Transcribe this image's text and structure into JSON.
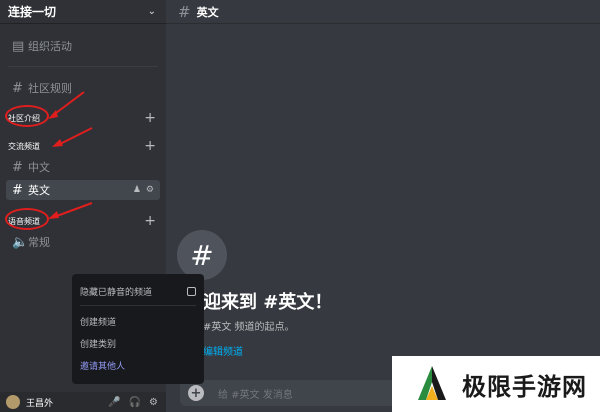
{
  "server": {
    "name": "连接一切"
  },
  "sidebar": {
    "top_item": "组织活动",
    "channels": [
      {
        "label": "社区规则"
      },
      {
        "label": "中文"
      },
      {
        "label": "英文"
      },
      {
        "label": "常规"
      }
    ],
    "categories": [
      {
        "label": "社区介绍"
      },
      {
        "label": "交流频道"
      },
      {
        "label": "语音频道"
      }
    ]
  },
  "user": {
    "name": "王昌外"
  },
  "main": {
    "channel_title": "英文",
    "welcome_title": "迎来到 #英文！",
    "welcome_sub": "#英文 频道的起点。",
    "edit_link": "编辑频道",
    "input_placeholder": "给 #英文 发消息"
  },
  "context_menu": {
    "items": [
      "隐藏已静音的频道",
      "创建频道",
      "创建类别",
      "邀请其他人"
    ]
  },
  "watermark": {
    "text": "极限手游网"
  },
  "colors": {
    "annotation": "#e01e1e",
    "accent_link": "#00aff4",
    "invite": "#949cf7"
  }
}
